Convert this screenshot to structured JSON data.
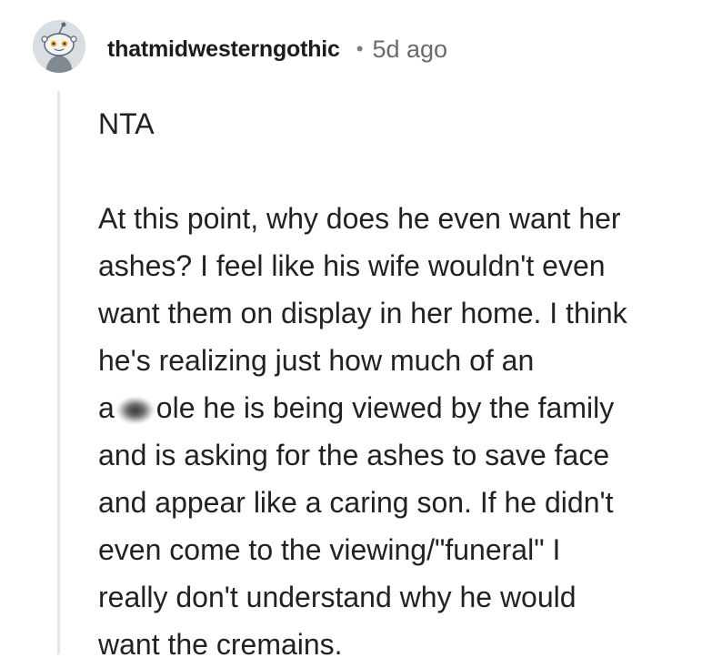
{
  "comment": {
    "author": "thatmidwesterngothic",
    "separator": "•",
    "timestamp": "5d ago",
    "avatar_icon": "snoo-avatar-icon",
    "body": {
      "first_paragraph": "NTA",
      "lines": [
        "At this point, why does he even want her",
        "ashes? I feel like his wife wouldn't even",
        "want them on display in her home. I think",
        "he's realizing just how much of an",
        "ole he is being viewed by the family",
        "and is asking for the ashes to save face",
        "and appear like a caring son. If he didn't",
        "even come to the viewing/\"funeral\" I",
        "really don't understand why he would",
        "want the cremains."
      ],
      "censored_word_prefix": "a"
    }
  },
  "colors": {
    "author": "#1c1c1c",
    "meta": "#6b6b6b",
    "body": "#222222",
    "thread_line": "#e6e6e6"
  }
}
